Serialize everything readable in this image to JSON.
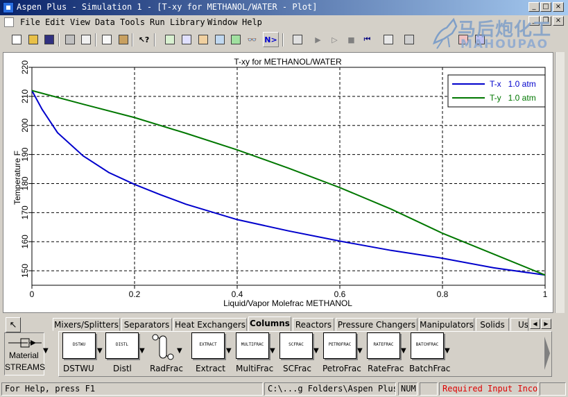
{
  "window": {
    "title": "Aspen Plus - Simulation 1 - [T-xy for METHANOL/WATER - Plot]",
    "buttons": {
      "minimize": "_",
      "maximize": "□",
      "close": "×"
    },
    "doc_buttons": {
      "minimize": "_",
      "restore": "❐",
      "close": "×"
    }
  },
  "menu": [
    "File",
    "Edit",
    "View",
    "Data",
    "Tools",
    "Run",
    "Library",
    "Window",
    "Help"
  ],
  "toolbar": {
    "next_label": "N>"
  },
  "watermark": {
    "line1": "马后炮化工",
    "line2": "MAHOUPAO"
  },
  "chart_data": {
    "type": "line",
    "title": "T-xy for METHANOL/WATER",
    "xlabel": "Liquid/Vapor Molefrac METHANOL",
    "ylabel": "Temperature F",
    "xlim": [
      0,
      1
    ],
    "ylim": [
      145,
      220
    ],
    "xticks": [
      "0",
      "0.2",
      "0.4",
      "0.6",
      "0.8",
      "1"
    ],
    "yticks": [
      "150",
      "160",
      "170",
      "180",
      "190",
      "200",
      "210",
      "220"
    ],
    "grid": true,
    "legend_position": "top-right",
    "series": [
      {
        "name": "T-x   1.0 atm",
        "color": "#0000cc",
        "x": [
          0,
          0.02,
          0.05,
          0.1,
          0.15,
          0.2,
          0.25,
          0.3,
          0.4,
          0.5,
          0.6,
          0.7,
          0.8,
          0.9,
          1.0
        ],
        "y": [
          212,
          205.5,
          197.5,
          189.5,
          183.8,
          179.7,
          176.2,
          172.9,
          167.6,
          163.7,
          160.2,
          157,
          154.3,
          151,
          148.5
        ]
      },
      {
        "name": "T-y   1.0 atm",
        "color": "#007700",
        "x": [
          0,
          0.1,
          0.2,
          0.3,
          0.4,
          0.5,
          0.6,
          0.7,
          0.8,
          0.9,
          1.0
        ],
        "y": [
          212,
          207.3,
          202.7,
          197.3,
          191.6,
          185.3,
          178.6,
          171.2,
          162.9,
          155.7,
          148.5
        ]
      }
    ]
  },
  "palette": {
    "tabs": [
      "Mixers/Splitters",
      "Separators",
      "Heat Exchangers",
      "Columns",
      "Reactors",
      "Pressure Changers",
      "Manipulators",
      "Solids",
      "User"
    ],
    "active_tab": "Columns",
    "streams": {
      "label1": "Material",
      "label2": "STREAMS"
    },
    "models": [
      {
        "label": "DSTWU",
        "icon_text": "DSTWU"
      },
      {
        "label": "Distl",
        "icon_text": "DISTL"
      },
      {
        "label": "RadFrac",
        "icon_text": ""
      },
      {
        "label": "Extract",
        "icon_text": "EXTRACT"
      },
      {
        "label": "MultiFrac",
        "icon_text": "MULTIFRAC"
      },
      {
        "label": "SCFrac",
        "icon_text": "SCFRAC"
      },
      {
        "label": "PetroFrac",
        "icon_text": "PETROFRAC"
      },
      {
        "label": "RateFrac",
        "icon_text": "RATEFRAC"
      },
      {
        "label": "BatchFrac",
        "icon_text": "BATCHFRAC"
      }
    ]
  },
  "status": {
    "help": "For Help, press F1",
    "path": "C:\\...g Folders\\Aspen Plus",
    "num": "NUM",
    "warning": "Required Input Incomple",
    "warning_color": "#dd0000"
  }
}
